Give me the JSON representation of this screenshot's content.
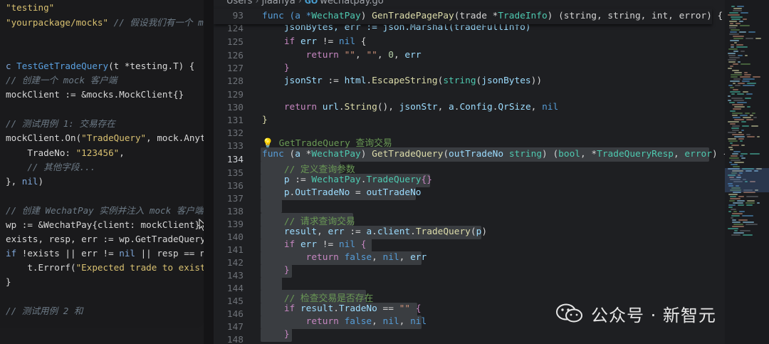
{
  "chat_pane": {
    "lines": [
      [
        "\"testing\""
      ],
      [
        "\"yourpackage/mocks\"",
        " // 假设我们有一个 mo"
      ],
      [
        ""
      ],
      [
        ""
      ],
      [
        "c ",
        "TestGetTradeQuery",
        "(t *testing.T) {"
      ],
      [
        "// 创建一个 mock 客户端"
      ],
      [
        "mockClient := &mocks.MockClient{}"
      ],
      [
        ""
      ],
      [
        "// 测试用例 1: 交易存在"
      ],
      [
        "mockClient.On(",
        "\"TradeQuery\"",
        ", mock.Anyt"
      ],
      [
        "    TradeNo: ",
        "\"123456\"",
        ","
      ],
      [
        "    // 其他字段..."
      ],
      [
        "}, ",
        "nil",
        ")"
      ],
      [
        ""
      ],
      [
        "// 创建 WechatPay 实例并注入 mock 客户端"
      ],
      [
        "wp := &WechatPay{client: mockClient}"
      ],
      [
        "exists, resp, err := wp.GetTradeQuery"
      ],
      [
        "if",
        " !exists || err != ",
        "nil",
        " || resp == n"
      ],
      [
        "    t.Errorf(",
        "\"Expected trade to exist"
      ],
      [
        "}"
      ],
      [
        ""
      ],
      [
        "// 测试用例 2 和"
      ]
    ]
  },
  "editor": {
    "breadcrumb": {
      "part1": "Users",
      "part2": "jiaanya",
      "file_icon": "GO",
      "file": "wechatpay.go"
    },
    "sticky": {
      "ln": "93",
      "code": [
        "func (a *",
        "WechatPay",
        ") ",
        "GenTradePagePay",
        "(trade *",
        "TradeInfo",
        ") (string, string, int, error) {"
      ]
    },
    "lines": [
      {
        "ln": "124",
        "code": [
          "    jsonBytes, err := json.Marshal(tradeFullInfo)"
        ]
      },
      {
        "ln": "125",
        "code": [
          "    if err != nil {"
        ]
      },
      {
        "ln": "126",
        "code": [
          "        return \"\", \"\", 0, err"
        ]
      },
      {
        "ln": "127",
        "code": [
          "    }"
        ]
      },
      {
        "ln": "128",
        "code": [
          "    jsonStr := html.EscapeString(string(jsonBytes))"
        ]
      },
      {
        "ln": "129",
        "code": [
          ""
        ]
      },
      {
        "ln": "130",
        "code": [
          "    return url.String(), jsonStr, a.Config.QrSize, nil"
        ]
      },
      {
        "ln": "131",
        "code": [
          "}"
        ]
      },
      {
        "ln": "132",
        "code": [
          ""
        ]
      },
      {
        "ln": "133",
        "code": [
          "💡 GetTradeQuery 查询交易"
        ]
      },
      {
        "ln": "134",
        "code": [
          "func (a *WechatPay) GetTradeQuery(outTradeNo string) (bool, *TradeQueryResp, error) {"
        ]
      },
      {
        "ln": "135",
        "code": [
          "    // 定义查询参数"
        ]
      },
      {
        "ln": "136",
        "code": [
          "    p := WechatPay.TradeQuery{}"
        ]
      },
      {
        "ln": "137",
        "code": [
          "    p.OutTradeNo = outTradeNo"
        ]
      },
      {
        "ln": "138",
        "code": [
          ""
        ]
      },
      {
        "ln": "139",
        "code": [
          "    // 请求查询交易"
        ]
      },
      {
        "ln": "140",
        "code": [
          "    result, err := a.client.TradeQuery(p)"
        ]
      },
      {
        "ln": "141",
        "code": [
          "    if err != nil {"
        ]
      },
      {
        "ln": "142",
        "code": [
          "        return false, nil, err"
        ]
      },
      {
        "ln": "143",
        "code": [
          "    }"
        ]
      },
      {
        "ln": "144",
        "code": [
          ""
        ]
      },
      {
        "ln": "145",
        "code": [
          "    // 检查交易是否存在"
        ]
      },
      {
        "ln": "146",
        "code": [
          "    if result.TradeNo == \"\" {"
        ]
      },
      {
        "ln": "147",
        "code": [
          "        return false, nil, nil"
        ]
      },
      {
        "ln": "148",
        "code": [
          "    }"
        ]
      }
    ]
  },
  "watermark": {
    "text": "公众号 · 新智元"
  },
  "colors": {
    "editor_bg": "#1e1f22",
    "selection": "#3a3d41",
    "type_teal": "#4ec9b0",
    "func_yellow": "#dcdcaa",
    "string_orange": "#ce9178",
    "comment_green": "#6a9955"
  }
}
